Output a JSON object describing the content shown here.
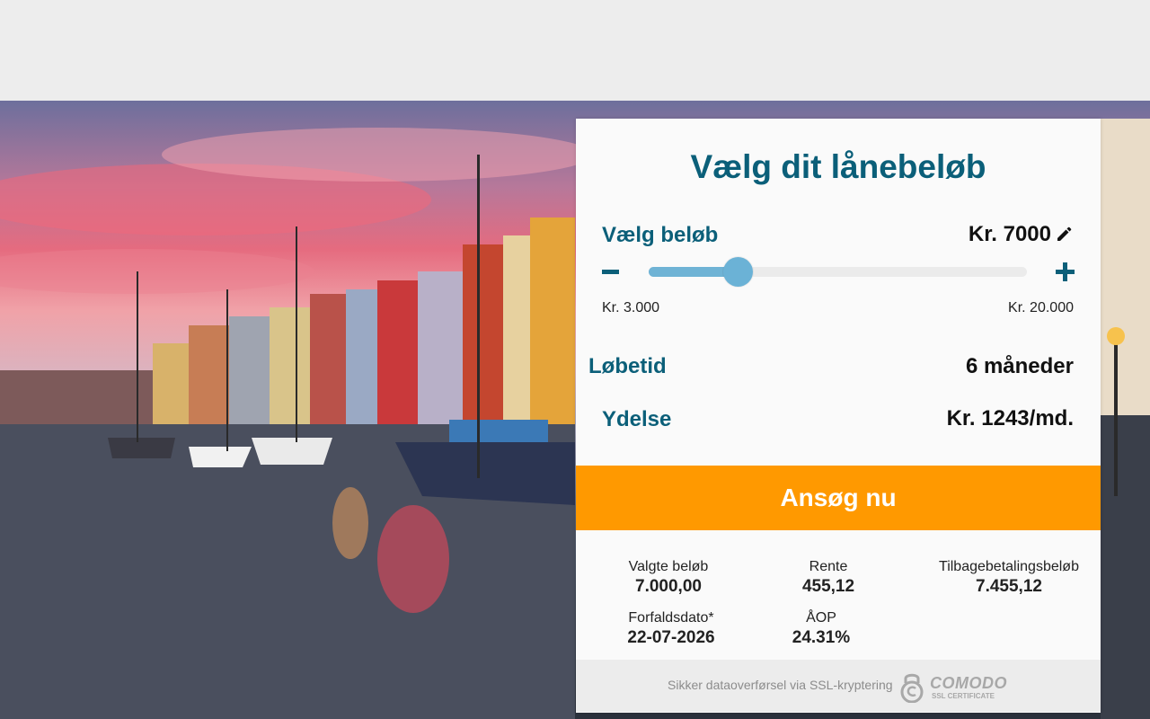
{
  "calculator": {
    "title": "Vælg dit lånebeløb",
    "amount_label": "Vælg beløb",
    "amount_value": "Kr. 7000",
    "slider": {
      "min_label": "Kr. 3.000",
      "max_label": "Kr. 20.000",
      "min": 3000,
      "max": 20000,
      "value": 7000
    },
    "term_label": "Løbetid",
    "term_value": "6 måneder",
    "payment_label": "Ydelse",
    "payment_value": "Kr. 1243/md.",
    "cta_label": "Ansøg nu"
  },
  "summary": {
    "chosen_amount": {
      "label": "Valgte beløb",
      "value": "7.000,00"
    },
    "interest": {
      "label": "Rente",
      "value": "455,12"
    },
    "repayment": {
      "label": "Tilbagebetalingsbeløb",
      "value": "7.455,12"
    },
    "due_date": {
      "label": "Forfaldsdato*",
      "value": "22-07-2026"
    },
    "apr": {
      "label": "ÅOP",
      "value": "24.31%"
    }
  },
  "footer": {
    "secure_text": "Sikker dataoverførsel via SSL-kryptering",
    "badge_name": "COMODO",
    "badge_sub": "SSL CERTIFICATE"
  },
  "colors": {
    "brand": "#0b5f79",
    "cta": "#ff9900",
    "slider": "#6fb3d5"
  },
  "icons": {
    "edit": "pencil-icon",
    "decrease": "minus-icon",
    "increase": "plus-icon",
    "badge": "lock-icon"
  }
}
